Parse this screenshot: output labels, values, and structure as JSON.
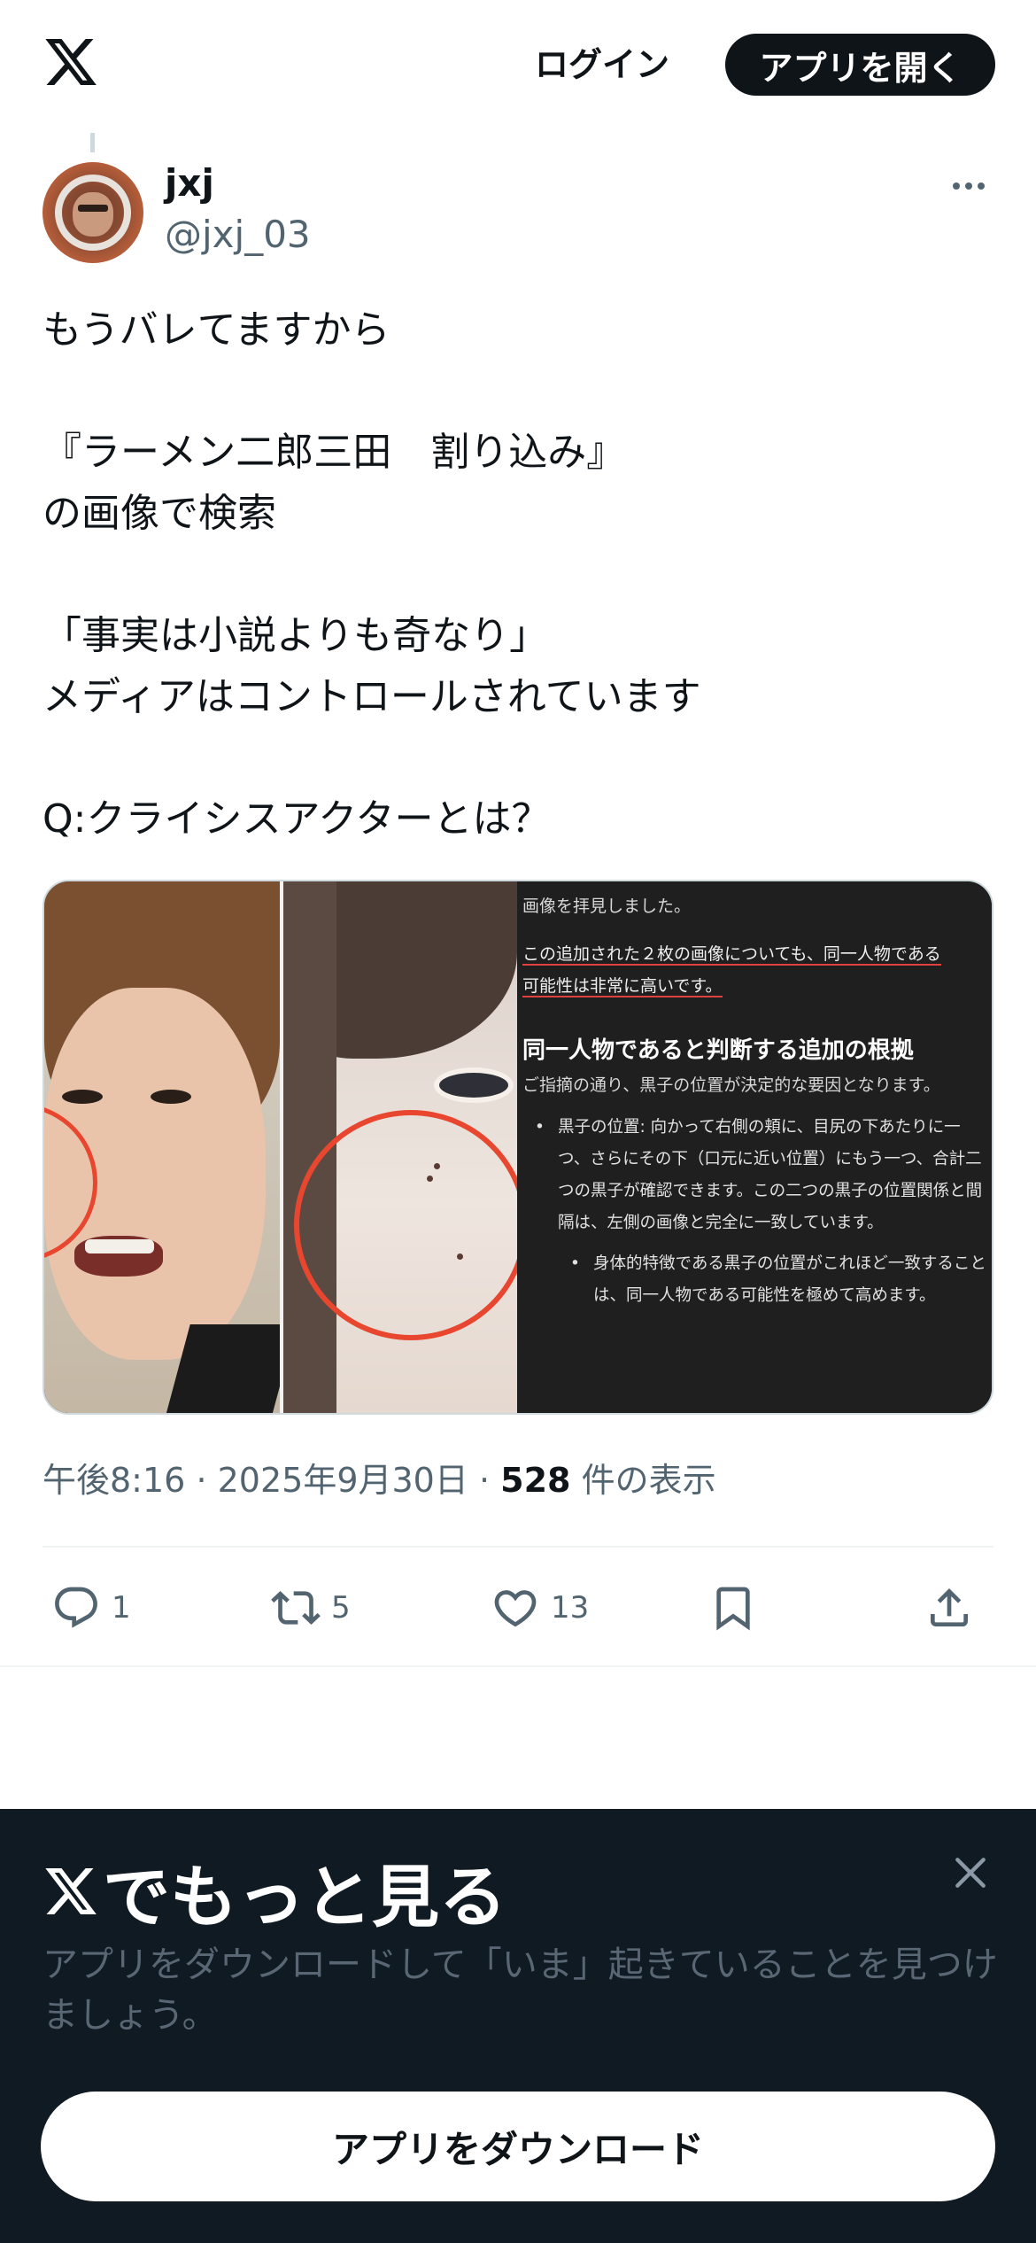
{
  "header": {
    "logo_icon": "x-logo-icon",
    "login_label": "ログイン",
    "open_app_label": "アプリを開く"
  },
  "tweet": {
    "display_name": "jxj",
    "handle": "@jxj_03",
    "text": "もうバレてますから\n\n『ラーメン二郎三田　割り込み』\nの画像で検索\n\n「事実は小説よりも奇なり」\nメディアはコントロールされています\n\nQ:クライシスアクターとは？",
    "media": {
      "screenshot_top": "画像を拝見しました。",
      "screenshot_highlight_1": "この追加された２枚の画像についても、同一人物である",
      "screenshot_highlight_2": "可能性は非常に高いです。",
      "screenshot_heading": "同一人物であると判断する追加の根拠",
      "screenshot_intro": "ご指摘の通り、黒子の位置が決定的な要因となります。",
      "screenshot_bullet_1": "黒子の位置: 向かって右側の頬に、目尻の下あたりに一つ、さらにその下（口元に近い位置）にもう一つ、合計二つの黒子が確認できます。この二つの黒子の位置関係と間隔は、左側の画像と完全に一致しています。",
      "screenshot_bullet_2": "身体的特徴である黒子の位置がこれほど一致することは、同一人物である可能性を極めて高めます。"
    },
    "time": "午後8:16",
    "date": "2025年9月30日",
    "views_count": "528",
    "views_label": "件の表示",
    "separator": "·",
    "actions": {
      "reply_count": "1",
      "retweet_count": "5",
      "like_count": "13"
    }
  },
  "bottom_sheet": {
    "title": "でもっと見る",
    "description": "アプリをダウンロードして「いま」起きていることを見つけましょう。",
    "download_label": "アプリをダウンロード"
  },
  "colors": {
    "text_primary": "#0f1419",
    "text_secondary": "#536471",
    "sheet_bg": "#101a23",
    "highlight_red": "#e8462f"
  }
}
